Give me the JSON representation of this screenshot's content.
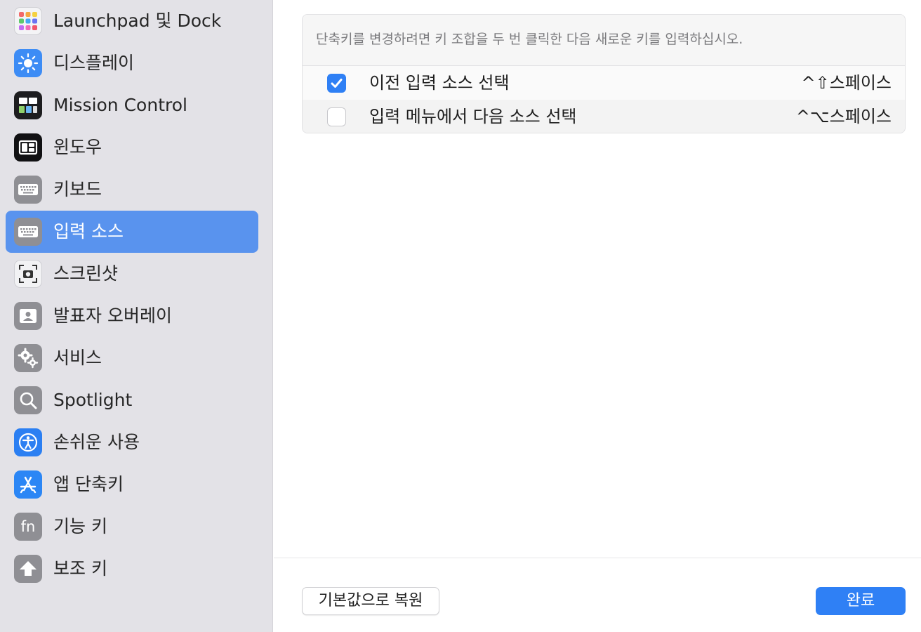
{
  "sidebar": {
    "items": [
      {
        "label": "Launchpad 및 Dock",
        "icon": "launchpad-icon"
      },
      {
        "label": "디스플레이",
        "icon": "display-brightness-icon"
      },
      {
        "label": "Mission Control",
        "icon": "mission-control-icon"
      },
      {
        "label": "윈도우",
        "icon": "window-icon"
      },
      {
        "label": "키보드",
        "icon": "keyboard-icon"
      },
      {
        "label": "입력 소스",
        "icon": "input-sources-keyboard-icon",
        "selected": true
      },
      {
        "label": "스크린샷",
        "icon": "screenshot-camera-icon"
      },
      {
        "label": "발표자 오버레이",
        "icon": "presenter-overlay-icon"
      },
      {
        "label": "서비스",
        "icon": "services-gears-icon"
      },
      {
        "label": "Spotlight",
        "icon": "spotlight-magnifier-icon"
      },
      {
        "label": "손쉬운 사용",
        "icon": "accessibility-icon"
      },
      {
        "label": "앱 단축키",
        "icon": "app-shortcuts-icon"
      },
      {
        "label": "기능 키",
        "icon": "fn-key-icon"
      },
      {
        "label": "보조 키",
        "icon": "modifier-key-icon"
      }
    ],
    "selected_color": "#5993ee"
  },
  "main": {
    "description": "단축키를 변경하려면 키 조합을 두 번 클릭한 다음 새로운 키를 입력하십시오.",
    "shortcuts": [
      {
        "label": "이전 입력 소스 선택",
        "keys": "^⇧스페이스",
        "checked": true
      },
      {
        "label": "입력 메뉴에서 다음 소스 선택",
        "keys": "^⌥스페이스",
        "checked": false
      }
    ]
  },
  "footer": {
    "restore_label": "기본값으로 복원",
    "done_label": "완료"
  },
  "colors": {
    "accent": "#2f80f5"
  }
}
